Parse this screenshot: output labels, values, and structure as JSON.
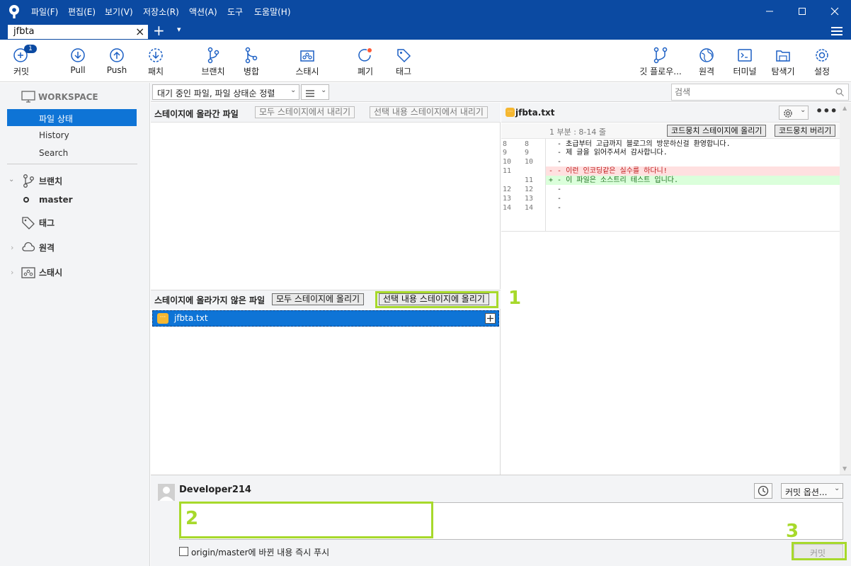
{
  "menu": {
    "items": [
      "파일(F)",
      "편집(E)",
      "보기(V)",
      "저장소(R)",
      "액션(A)",
      "도구",
      "도움말(H)"
    ]
  },
  "tabs": {
    "active": "jfbta",
    "close_icon": "×",
    "add_icon": "+",
    "dropdown_icon": "▾"
  },
  "toolbar": {
    "commit_label": "커밋",
    "commit_badge": "1",
    "pull_label": "Pull",
    "push_label": "Push",
    "fetch_label": "패치",
    "branch_label": "브랜치",
    "merge_label": "병합",
    "stash_label": "스태시",
    "discard_label": "폐기",
    "tag_label": "태그",
    "gitflow_label": "깃 플로우...",
    "remote_label": "원격",
    "terminal_label": "터미널",
    "explorer_label": "탐색기",
    "settings_label": "설정"
  },
  "sidebar": {
    "workspace": "WORKSPACE",
    "file_status": "파일 상태",
    "history": "History",
    "search": "Search",
    "branches": "브랜치",
    "master": "master",
    "tags": "태그",
    "remotes": "원격",
    "stashes": "스태시"
  },
  "filter": {
    "sort_label": "대기 중인 파일, 파일 상태순 정렬",
    "search_placeholder": "검색"
  },
  "staged": {
    "title": "스테이지에 올라간 파일",
    "unstage_all": "모두 스테이지에서 내리기",
    "unstage_selected": "선택 내용 스테이지에서 내리기"
  },
  "unstaged": {
    "title": "스테이지에 올라가지 않은 파일",
    "stage_all": "모두 스테이지에 올리기",
    "stage_selected": "선택 내용 스테이지에 올리기",
    "files": [
      {
        "name": "jfbta.txt"
      }
    ]
  },
  "diff": {
    "file": "jfbta.txt",
    "hunk": "1 부분 : 8-14 줄",
    "stage_hunk": "코드뭉치 스테이지에 올리기",
    "discard_hunk": "코드뭉치 버리기",
    "lines": [
      {
        "old": "8",
        "new": "8",
        "type": "ctx",
        "text": "  - 초급부터 고급까지 블로그의 방문하신걸 환영합니다."
      },
      {
        "old": "9",
        "new": "9",
        "type": "ctx",
        "text": "  - 제 글을 읽어주셔서 감사합니다."
      },
      {
        "old": "10",
        "new": "10",
        "type": "ctx",
        "text": "  -"
      },
      {
        "old": "11",
        "new": "",
        "type": "del",
        "text": "- - 이런 인코딩같은 실수를 하다니!"
      },
      {
        "old": "",
        "new": "11",
        "type": "add",
        "text": "+ - 이 파일은 소스트리 테스트 입니다."
      },
      {
        "old": "12",
        "new": "12",
        "type": "ctx",
        "text": "  -"
      },
      {
        "old": "13",
        "new": "13",
        "type": "ctx",
        "text": "  -"
      },
      {
        "old": "14",
        "new": "14",
        "type": "ctx",
        "text": "  -"
      }
    ]
  },
  "commit": {
    "author": "Developer214",
    "options": "커밋 옵션...",
    "message": "",
    "push_checkbox": "origin/master에 바뀐 내용 즉시 푸시",
    "commit_button": "커밋"
  },
  "annotations": {
    "one": "1",
    "two": "2",
    "three": "3"
  },
  "colors": {
    "titlebar": "#0b4aa2",
    "selection": "#0e74d6",
    "highlight": "#a7d92b",
    "added_bg": "#dbffdb",
    "removed_bg": "#ffe0e0"
  }
}
